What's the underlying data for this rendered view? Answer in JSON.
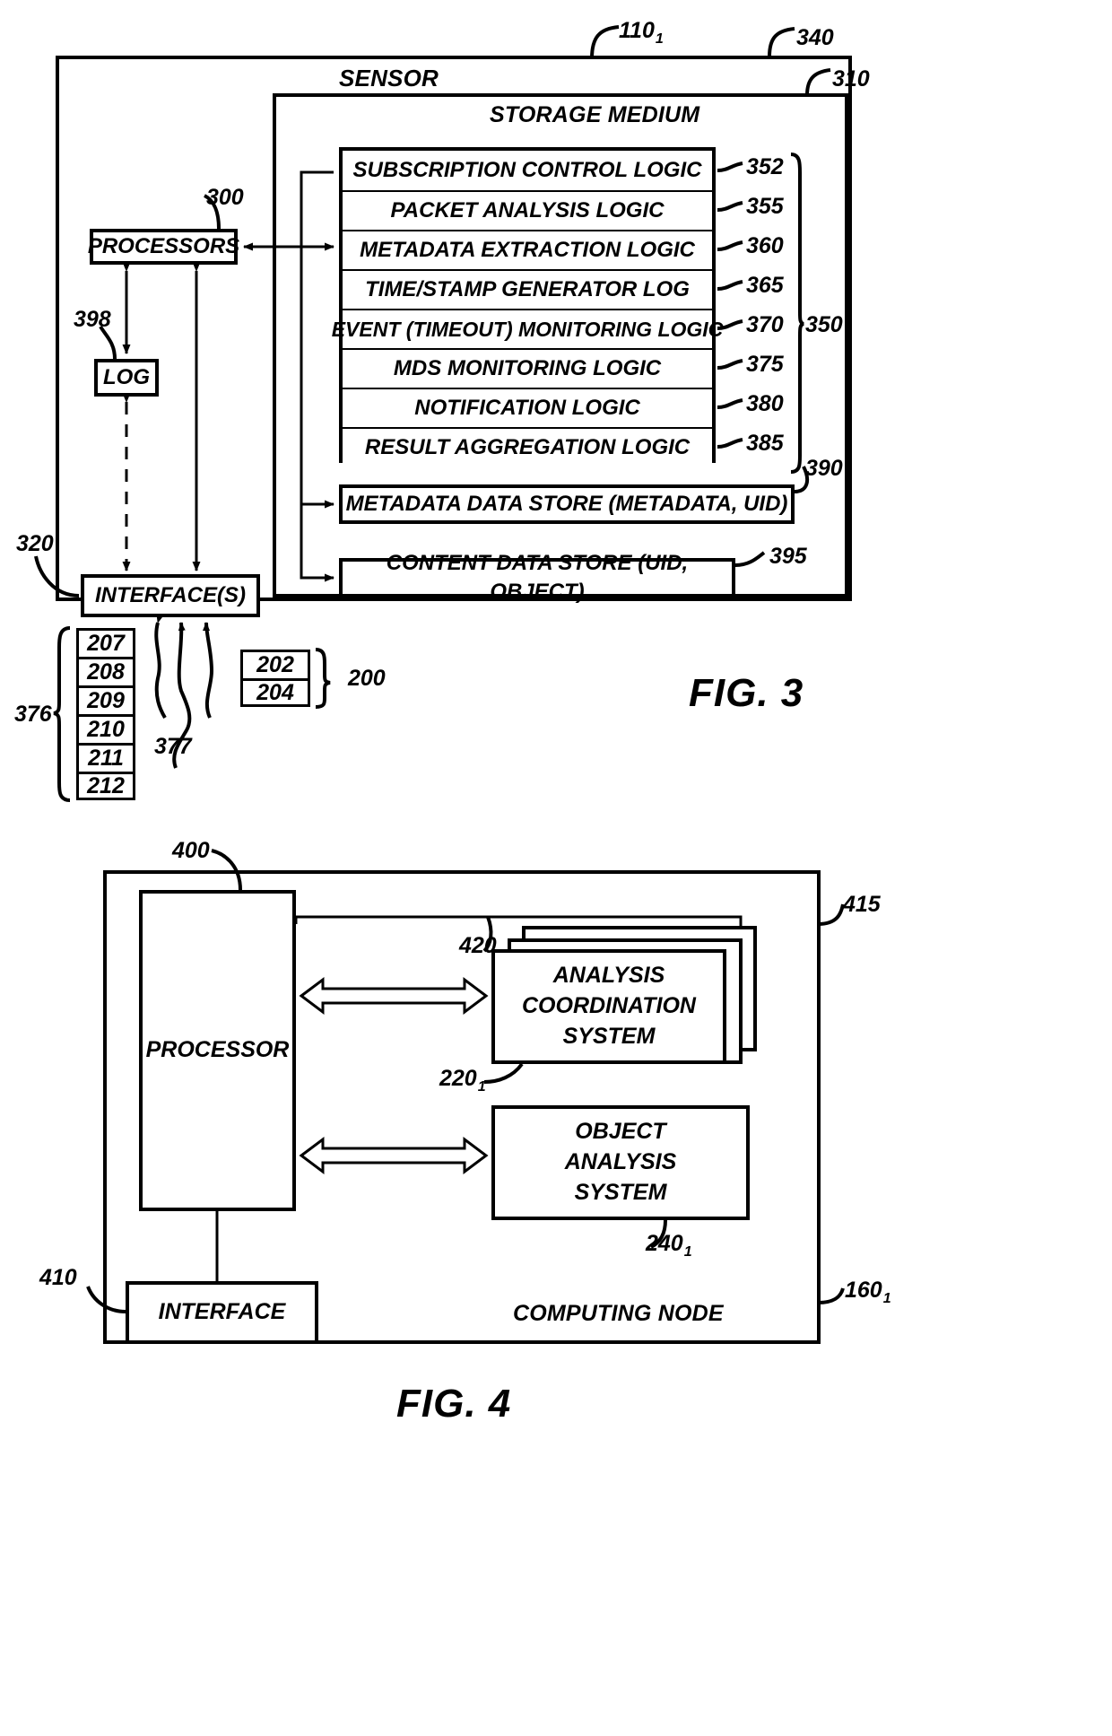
{
  "figures": [
    {
      "id": "fig3",
      "title": "FIG. 3",
      "outer_label": "SENSOR",
      "outer_ref": "110",
      "outer_ref_sub": "1",
      "outer_ref_right": "340",
      "inner_label": "STORAGE MEDIUM",
      "inner_ref": "310",
      "processors_label": "PROCESSORS",
      "processors_ref": "300",
      "log_label": "LOG",
      "log_ref": "398",
      "interface_label": "INTERFACE(S)",
      "interface_ref": "320",
      "logic_group_ref": "350",
      "logic_rows": [
        {
          "label": "SUBSCRIPTION CONTROL LOGIC",
          "ref": "352"
        },
        {
          "label": "PACKET ANALYSIS LOGIC",
          "ref": "355"
        },
        {
          "label": "METADATA EXTRACTION LOGIC",
          "ref": "360"
        },
        {
          "label": "TIME/STAMP GENERATOR LOG",
          "ref": "365"
        },
        {
          "label": "EVENT (TIMEOUT) MONITORING LOGIC",
          "ref": "370"
        },
        {
          "label": "MDS MONITORING LOGIC",
          "ref": "375"
        },
        {
          "label": "NOTIFICATION LOGIC",
          "ref": "380"
        },
        {
          "label": "RESULT AGGREGATION LOGIC",
          "ref": "385"
        }
      ],
      "stores": [
        {
          "label": "METADATA DATA STORE  (METADATA, UID)",
          "ref": "390"
        },
        {
          "label": "CONTENT DATA STORE (UID, OBJECT)",
          "ref": "395"
        }
      ],
      "packet_stack_ref": "376",
      "packet_stack": [
        "207",
        "208",
        "209",
        "210",
        "211",
        "212"
      ],
      "flow_ref": "377",
      "object_stack_ref": "200",
      "object_stack": [
        "202",
        "204"
      ]
    },
    {
      "id": "fig4",
      "title": "FIG. 4",
      "outer_label": "COMPUTING NODE",
      "outer_ref": "160",
      "outer_ref_sub": "1",
      "processor_label": "PROCESSOR",
      "processor_ref": "400",
      "bus_ref": "420",
      "interface_label": "INTERFACE",
      "interface_ref": "410",
      "acs_label_lines": [
        "ANALYSIS",
        "COORDINATION",
        "SYSTEM"
      ],
      "acs_ref": "220",
      "acs_ref_sub": "1",
      "acs_stack_ref": "415",
      "oas_label_lines": [
        "OBJECT",
        "ANALYSIS",
        "SYSTEM"
      ],
      "oas_ref": "240",
      "oas_ref_sub": "1"
    }
  ],
  "colors": {
    "ink": "#000000",
    "paper": "#ffffff"
  }
}
